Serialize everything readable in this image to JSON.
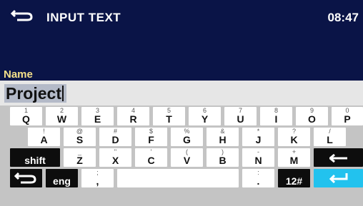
{
  "header": {
    "title": "INPUT TEXT",
    "time": "08:47",
    "back_icon": "back-arrow-icon"
  },
  "field": {
    "label": "Name",
    "value": "Project"
  },
  "keyboard": {
    "row1": [
      {
        "primary": "Q",
        "secondary": "1"
      },
      {
        "primary": "W",
        "secondary": "2"
      },
      {
        "primary": "E",
        "secondary": "3"
      },
      {
        "primary": "R",
        "secondary": "4"
      },
      {
        "primary": "T",
        "secondary": "5"
      },
      {
        "primary": "Y",
        "secondary": "6"
      },
      {
        "primary": "U",
        "secondary": "7"
      },
      {
        "primary": "I",
        "secondary": "8"
      },
      {
        "primary": "O",
        "secondary": "9"
      },
      {
        "primary": "P",
        "secondary": "0"
      }
    ],
    "row2": [
      {
        "primary": "A",
        "secondary": "!"
      },
      {
        "primary": "S",
        "secondary": "@"
      },
      {
        "primary": "D",
        "secondary": "#"
      },
      {
        "primary": "F",
        "secondary": "$"
      },
      {
        "primary": "G",
        "secondary": "%"
      },
      {
        "primary": "H",
        "secondary": "&"
      },
      {
        "primary": "J",
        "secondary": "*"
      },
      {
        "primary": "K",
        "secondary": "?"
      },
      {
        "primary": "L",
        "secondary": "/"
      }
    ],
    "row3": [
      {
        "primary": "Z",
        "secondary": "_"
      },
      {
        "primary": "X",
        "secondary": "\""
      },
      {
        "primary": "C",
        "secondary": "'"
      },
      {
        "primary": "V",
        "secondary": "("
      },
      {
        "primary": "B",
        "secondary": ")"
      },
      {
        "primary": "N",
        "secondary": "-"
      },
      {
        "primary": "M",
        "secondary": "+"
      }
    ],
    "row4": [
      {
        "primary": ",",
        "secondary": ";"
      },
      {
        "primary": ".",
        "secondary": ":"
      }
    ],
    "shift_label": "shift",
    "lang_label": "eng",
    "mode_label": "12#",
    "backspace_icon": "backspace-arrow-icon",
    "back_icon": "back-arrow-icon",
    "enter_icon": "enter-icon"
  },
  "colors": {
    "header_bg": "#0a1447",
    "label_color": "#f5e08a",
    "keyboard_bg": "#c4c4c4",
    "enter_key": "#22c2ee",
    "dark_key": "#0d0d0d"
  }
}
